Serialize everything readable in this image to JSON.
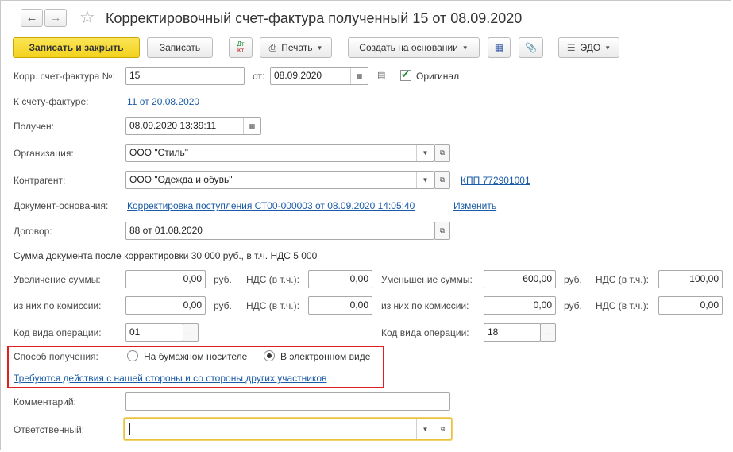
{
  "window": {
    "title": "Корректировочный счет-фактура полученный 15 от 08.09.2020"
  },
  "toolbar": {
    "save_close": "Записать и закрыть",
    "save": "Записать",
    "dtkt": "Дт\nКт",
    "print": "Печать",
    "create_based": "Создать на основании",
    "edo": "ЭДО"
  },
  "form": {
    "corr_invoice_label": "Корр. счет-фактура №:",
    "corr_invoice_value": "15",
    "from_label": "от:",
    "from_value": "08.09.2020",
    "original_label": "Оригинал",
    "to_invoice_label": "К счету-фактуре:",
    "to_invoice_link": "11 от 20.08.2020",
    "received_label": "Получен:",
    "received_value": "08.09.2020 13:39:11",
    "org_label": "Организация:",
    "org_value": "ООО \"Стиль\"",
    "contractor_label": "Контрагент:",
    "contractor_value": "ООО \"Одежда и обувь\"",
    "kpp_link": "КПП 772901001",
    "basis_label": "Документ-основания:",
    "basis_link": "Корректировка поступления СТ00-000003 от 08.09.2020 14:05:40",
    "change_link": "Изменить",
    "contract_label": "Договор:",
    "contract_value": "88 от 01.08.2020",
    "sum_text": "Сумма документа после корректировки 30 000 руб., в т.ч. НДС 5 000",
    "increase_label": "Увеличение суммы:",
    "increase_value": "0,00",
    "rub": "руб.",
    "vat_label": "НДС (в т.ч.):",
    "increase_vat": "0,00",
    "decrease_label": "Уменьшение суммы:",
    "decrease_value": "600,00",
    "decrease_vat": "100,00",
    "commission_label": "из них по комиссии:",
    "commission_inc": "0,00",
    "commission_inc_vat": "0,00",
    "commission_dec": "0,00",
    "commission_dec_vat": "0,00",
    "op_code_label": "Код вида операции:",
    "op_code_left": "01",
    "op_code_right": "18",
    "receipt_label": "Способ получения:",
    "receipt_paper": "На бумажном носителе",
    "receipt_electronic": "В электронном виде",
    "action_link": "Требуются действия с нашей стороны и со стороны других участников",
    "comment_label": "Комментарий:",
    "comment_value": "",
    "responsible_label": "Ответственный:",
    "responsible_value": ""
  },
  "colors": {
    "primary_button": "#f3d21d",
    "link": "#1a5ba7",
    "highlight_box": "#e02020",
    "focus_border": "#e7c23a"
  }
}
